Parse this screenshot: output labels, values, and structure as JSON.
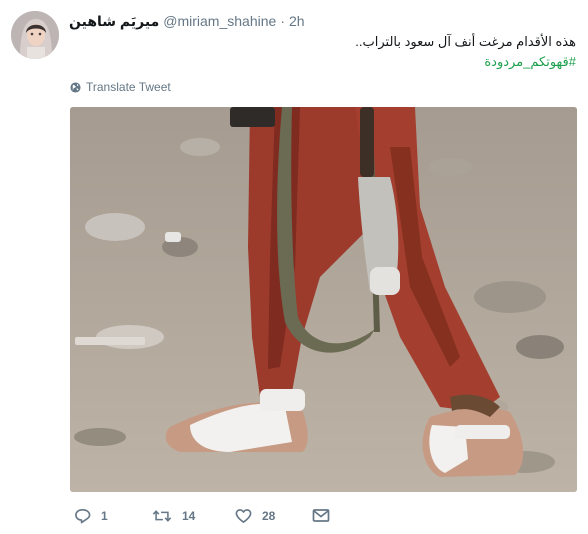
{
  "tweet": {
    "display_name": "ميريَم شاهين",
    "handle": "@miriam_shahine",
    "separator": "·",
    "time": "2h",
    "text_line": "هذه الأقدام مرغت أنف آل سعود بالتراب..",
    "hashtag": "#قهوتكم_مردودة",
    "translate_label": "Translate Tweet"
  },
  "actions": {
    "reply_count": "1",
    "retweet_count": "14",
    "like_count": "28"
  },
  "icons": {
    "globe": "globe-icon",
    "reply": "reply-icon",
    "retweet": "retweet-icon",
    "like": "heart-icon",
    "dm": "envelope-icon"
  },
  "colors": {
    "hashtag": "#1da04d",
    "secondary_text": "#657786",
    "primary_text": "#14171a"
  }
}
